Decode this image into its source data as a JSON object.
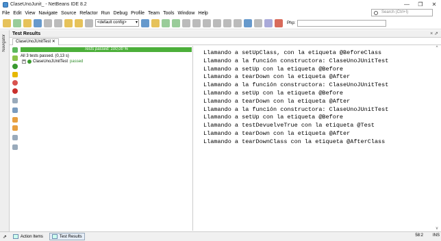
{
  "window": {
    "title": "ClaseUnoJunit_ - NetBeans IDE 8.2",
    "controls": {
      "minimize": "—",
      "maximize": "❐",
      "close": "✕"
    }
  },
  "menu": [
    "File",
    "Edit",
    "View",
    "Navigate",
    "Source",
    "Refactor",
    "Run",
    "Debug",
    "Profile",
    "Team",
    "Tools",
    "Window",
    "Help"
  ],
  "search": {
    "placeholder": "Search (Ctrl+I)"
  },
  "toolbar": {
    "config": "<default config>",
    "php_label": "Php:"
  },
  "sidebar": {
    "label": "Navigator"
  },
  "panel": {
    "title": "Test Results",
    "controls": "× ⇗"
  },
  "tab": {
    "label": "ClaseUnoJUnitTest ✕"
  },
  "results": {
    "progress_text": "Tests passed: 100,00 %",
    "progress": 1.0,
    "summary": "All 3 tests passed. (0,13 s)",
    "suite": "ClaseUnoJUnitTest",
    "suite_status": "passed"
  },
  "output_lines": [
    "Llamando a setUpClass, con la etiqueta @BeforeClass",
    "Llamando a la función constructora: ClaseUnoJUnitTest",
    "Llamando a setUp con la etiqueta @Before",
    "Llamando a tearDown con la etiqueta @After",
    "Llamando a la función constructora: ClaseUnoJUnitTest",
    "Llamando a setUp con la etiqueta @Before",
    "Llamando a tearDown con la etiqueta @After",
    "Llamando a la función constructora: ClaseUnoJUnitTest",
    "Llamando a setUp con la etiqueta @Before",
    "Llamando a testDevuelveTrue con la etiqueta @Test",
    "Llamando a tearDown con la etiqueta @After",
    "Llamando a tearDownClass con la etiqueta @AfterClass"
  ],
  "statusbar": {
    "items": [
      "Action Items",
      "Test Results"
    ],
    "caret": "58:2",
    "mode": "INS"
  },
  "colors": {
    "progress": "#4caf3a",
    "passed": "#2e8b28"
  }
}
